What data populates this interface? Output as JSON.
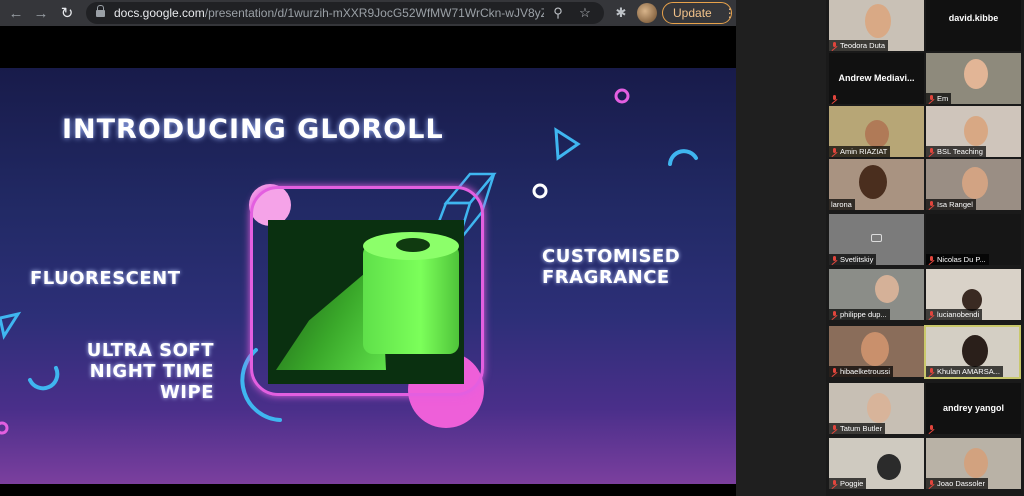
{
  "browser": {
    "url_host": "docs.google.com",
    "url_path": "/presentation/d/1wurzih-mXXR9JocG52WfMW71WrCkn-wJV8yZ...",
    "update_label": "Update",
    "back_icon": "back-arrow-icon",
    "forward_icon": "forward-arrow-icon",
    "reload_icon": "reload-icon"
  },
  "slide": {
    "title": "INTRODUCING GLOROLL",
    "left_feature": "FLUORESCENT",
    "bottom_feature_line1": "ULTRA SOFT",
    "bottom_feature_line2": "NIGHT TIME",
    "bottom_feature_line3": "WIPE",
    "right_feature_line1": "CUSTOMISED",
    "right_feature_line2": "FRAGRANCE",
    "accent_pink": "#e35fe0",
    "accent_cyan": "#3fb6f0"
  },
  "participants": [
    {
      "name": "Teodora Duta",
      "video": true
    },
    {
      "name": "david.kibbe",
      "video": false
    },
    {
      "name": "Andrew Mediavi...",
      "video": false
    },
    {
      "name": "Em",
      "video": true
    },
    {
      "name": "Amin RIAZIAT",
      "video": true
    },
    {
      "name": "BSL Teaching",
      "video": true
    },
    {
      "name": "larona",
      "video": true
    },
    {
      "name": "Isa Rangel",
      "video": true
    },
    {
      "name": "Svetlitskiy",
      "video": false
    },
    {
      "name": "Nicolas Du P...",
      "video": false
    },
    {
      "name": "philippe dup...",
      "video": true
    },
    {
      "name": "lucianobendi",
      "video": true
    },
    {
      "name": "hibaelketroussi",
      "video": true
    },
    {
      "name": "Khulan AMARSA...",
      "video": true
    },
    {
      "name": "Tatum Butler",
      "video": true
    },
    {
      "name": "andrey yangol",
      "video": false
    },
    {
      "name": "Poggie",
      "video": true
    },
    {
      "name": "Joao Dassoler",
      "video": true
    }
  ]
}
